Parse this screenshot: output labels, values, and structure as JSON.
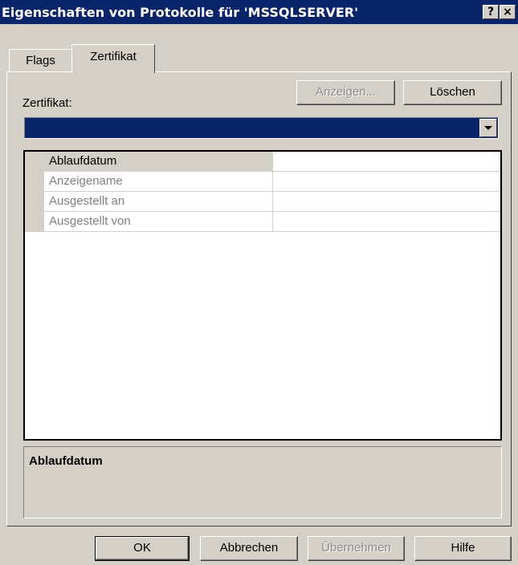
{
  "window": {
    "title": "Eigenschaften von Protokolle für 'MSSQLSERVER'",
    "help_button": "?",
    "close_button": "×"
  },
  "tabs": [
    {
      "label": "Flags",
      "active": false
    },
    {
      "label": "Zertifikat",
      "active": true
    }
  ],
  "certificate": {
    "label": "Zertifikat:",
    "view_button": "Anzeigen...",
    "delete_button": "Löschen",
    "selected_value": ""
  },
  "property_grid": {
    "rows": [
      {
        "name": "Ablaufdatum",
        "value": "",
        "selected": true
      },
      {
        "name": "Anzeigename",
        "value": "",
        "selected": false
      },
      {
        "name": "Ausgestellt an",
        "value": "",
        "selected": false
      },
      {
        "name": "Ausgestellt von",
        "value": "",
        "selected": false
      }
    ]
  },
  "description": {
    "title": "Ablaufdatum",
    "text": ""
  },
  "buttons": {
    "ok": "OK",
    "cancel": "Abbrechen",
    "apply": "Übernehmen",
    "help": "Hilfe"
  },
  "colors": {
    "titlebar": "#0a246a",
    "face": "#d4d0c8",
    "selection": "#0a246a"
  }
}
